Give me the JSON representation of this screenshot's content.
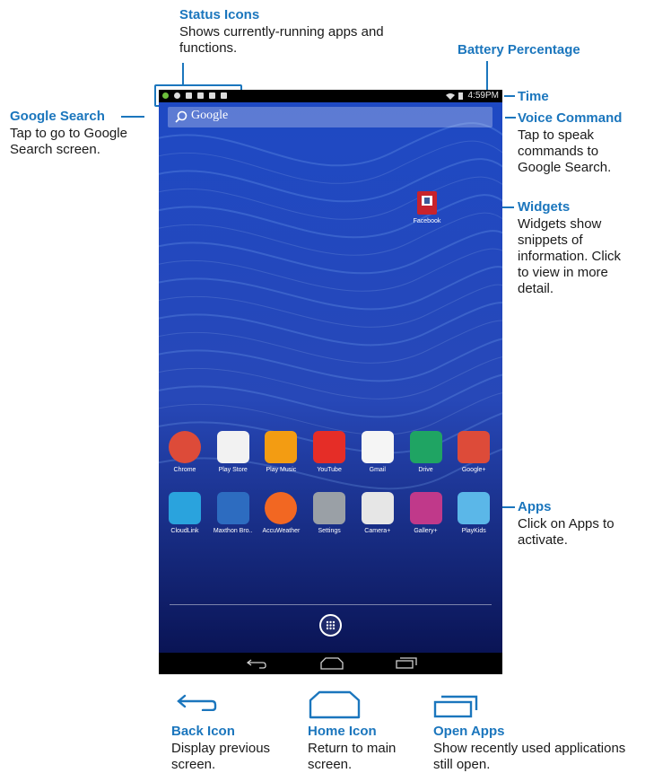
{
  "callouts": {
    "status_icons": {
      "title": "Status Icons",
      "desc": "Shows currently-running apps and functions."
    },
    "battery": {
      "title": "Battery Percentage"
    },
    "time": {
      "title": "Time"
    },
    "google_search": {
      "title": "Google Search",
      "desc": "Tap to go to Google Search screen."
    },
    "voice_command": {
      "title": "Voice Command",
      "desc": "Tap to speak commands to Google Search."
    },
    "widgets": {
      "title": "Widgets",
      "desc": "Widgets show snippets of information. Click to view in more detail."
    },
    "apps": {
      "title": "Apps",
      "desc": "Click on Apps to activate."
    },
    "back_icon": {
      "title": "Back Icon",
      "desc": "Display previous screen."
    },
    "home_icon": {
      "title": "Home Icon",
      "desc": "Return to main screen."
    },
    "open_apps": {
      "title": "Open Apps",
      "desc": "Show recently used applications still open."
    }
  },
  "device": {
    "status_time": "4:59PM",
    "search_placeholder": "Google",
    "widget": {
      "label": "Facebook",
      "icon": "facebook-icon"
    },
    "apps_row1": [
      {
        "label": "Chrome",
        "icon": "chrome-icon",
        "color": "#dd4b39"
      },
      {
        "label": "Play Store",
        "icon": "play-store-icon",
        "color": "#f2f2f2"
      },
      {
        "label": "Play Music",
        "icon": "play-music-icon",
        "color": "#f39c12"
      },
      {
        "label": "YouTube",
        "icon": "youtube-icon",
        "color": "#e52d27"
      },
      {
        "label": "Gmail",
        "icon": "gmail-icon",
        "color": "#f5f5f5"
      },
      {
        "label": "Drive",
        "icon": "drive-icon",
        "color": "#1fa463"
      },
      {
        "label": "Google+",
        "icon": "google-plus-icon",
        "color": "#dd4b39"
      }
    ],
    "apps_row2": [
      {
        "label": "CloudLink",
        "icon": "cloudlink-icon",
        "color": "#2aa3dd"
      },
      {
        "label": "Maxthon Bro..",
        "icon": "maxthon-icon",
        "color": "#2d6cc0"
      },
      {
        "label": "AccuWeather",
        "icon": "accuweather-icon",
        "color": "#f26722"
      },
      {
        "label": "Settings",
        "icon": "settings-icon",
        "color": "#9aa0a6"
      },
      {
        "label": "Camera+",
        "icon": "camera-icon",
        "color": "#e6e6e6"
      },
      {
        "label": "Gallery+",
        "icon": "gallery-icon",
        "color": "#c0398a"
      },
      {
        "label": "PlayKids",
        "icon": "playkids-icon",
        "color": "#5bb7e8"
      }
    ]
  },
  "colors": {
    "accent": "#1b76bd",
    "wallpaper": "#0b1f6f"
  }
}
